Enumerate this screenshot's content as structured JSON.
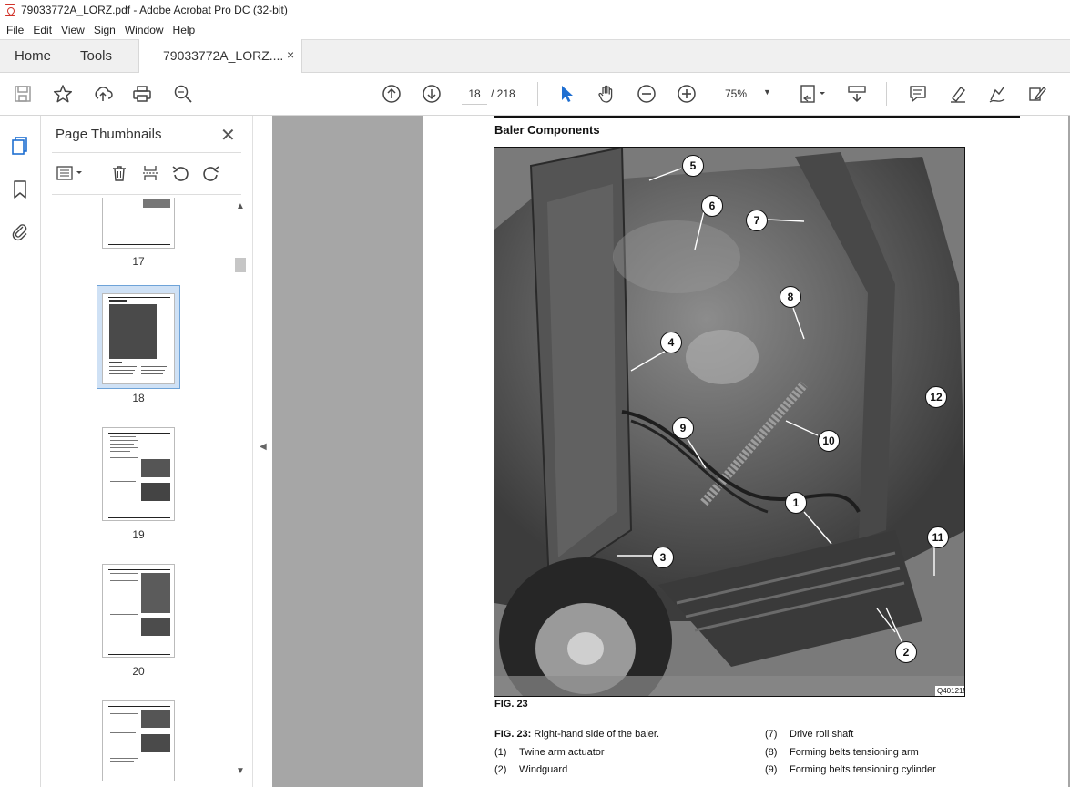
{
  "window": {
    "title": "79033772A_LORZ.pdf - Adobe Acrobat Pro DC (32-bit)"
  },
  "menu": [
    "File",
    "Edit",
    "View",
    "Sign",
    "Window",
    "Help"
  ],
  "tabs": {
    "home": "Home",
    "tools": "Tools",
    "document": "79033772A_LORZ....",
    "close": "×"
  },
  "toolbar": {
    "icons": [
      "save-icon",
      "star-icon",
      "upload-icon",
      "print-icon",
      "search-zoom-icon",
      "page-up-icon",
      "page-down-icon",
      "select-cursor-icon",
      "hand-icon",
      "zoom-out-icon",
      "zoom-in-icon",
      "fit-page-icon",
      "scroll-mode-icon",
      "comment-icon",
      "highlight-icon",
      "sign-icon",
      "edit-icon"
    ],
    "current_page": "18",
    "total_pages": "/ 218",
    "zoom": "75%"
  },
  "panel": {
    "title": "Page Thumbnails",
    "close": "✕",
    "thumbnails": [
      {
        "label": "17"
      },
      {
        "label": "18"
      },
      {
        "label": "19"
      },
      {
        "label": "20"
      }
    ]
  },
  "document": {
    "heading": "Baler Components",
    "figure": "FIG. 23",
    "image_code": "Q401215",
    "callouts": [
      "1",
      "2",
      "3",
      "4",
      "5",
      "6",
      "7",
      "8",
      "9",
      "10",
      "11",
      "12"
    ],
    "caption_title": "FIG. 23:",
    "caption_text": "Right-hand side of the baler.",
    "legend_left": [
      {
        "num": "(1)",
        "text": "Twine arm actuator"
      },
      {
        "num": "(2)",
        "text": "Windguard"
      }
    ],
    "legend_right": [
      {
        "num": "(7)",
        "text": "Drive roll shaft"
      },
      {
        "num": "(8)",
        "text": "Forming belts tensioning arm"
      },
      {
        "num": "(9)",
        "text": "Forming belts tensioning cylinder"
      }
    ]
  }
}
